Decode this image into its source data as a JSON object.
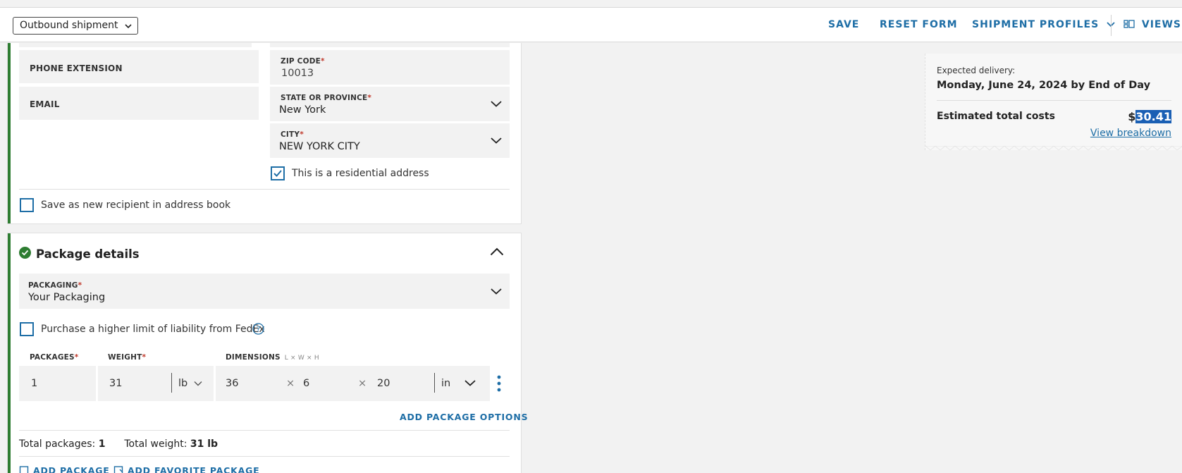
{
  "header": {
    "shipment_type": "Outbound shipment",
    "save": "SAVE",
    "reset_form": "RESET FORM",
    "shipment_profiles": "SHIPMENT PROFILES",
    "views": "VIEWS"
  },
  "recipient": {
    "phone_extension_label": "PHONE EXTENSION",
    "email_label": "EMAIL",
    "zip_label": "ZIP CODE",
    "zip_value": "10013",
    "state_label": "STATE OR PROVINCE",
    "state_value": "New York",
    "city_label": "CITY",
    "city_value": "NEW YORK CITY",
    "residential_label": "This is a residential address",
    "residential_checked": true,
    "save_recipient_label": "Save as new recipient in address book",
    "save_recipient_checked": false,
    "required_mark": "*"
  },
  "package": {
    "title": "Package details",
    "packaging_label": "PACKAGING",
    "packaging_value": "Your Packaging",
    "liability_label": "Purchase a higher limit of liability from FedEx",
    "liability_checked": false,
    "packages_label": "PACKAGES",
    "weight_label": "WEIGHT",
    "dimensions_label": "DIMENSIONS",
    "dimensions_hint": "L × W × H",
    "packages_value": "1",
    "weight_value": "31",
    "weight_unit": "lb",
    "dim_length": "36",
    "dim_width": "6",
    "dim_height": "20",
    "dim_unit": "in",
    "times": "×",
    "add_package_options": "ADD PACKAGE OPTIONS",
    "total_packages_label": "Total packages:",
    "total_packages_value": "1",
    "total_weight_label": "Total weight:",
    "total_weight_value": "31 lb",
    "add_package": "ADD PACKAGE",
    "add_favorite_package": "ADD FAVORITE PACKAGE"
  },
  "summary": {
    "expected_delivery_label": "Expected delivery:",
    "expected_delivery_value": "Monday, June 24, 2024 by End of Day",
    "estimated_total_label": "Estimated total costs",
    "currency": "$",
    "amount": "30.41",
    "view_breakdown": "View breakdown"
  },
  "colors": {
    "accent": "#1e6ea6",
    "success": "#2e7d32",
    "required": "#c0392b"
  }
}
